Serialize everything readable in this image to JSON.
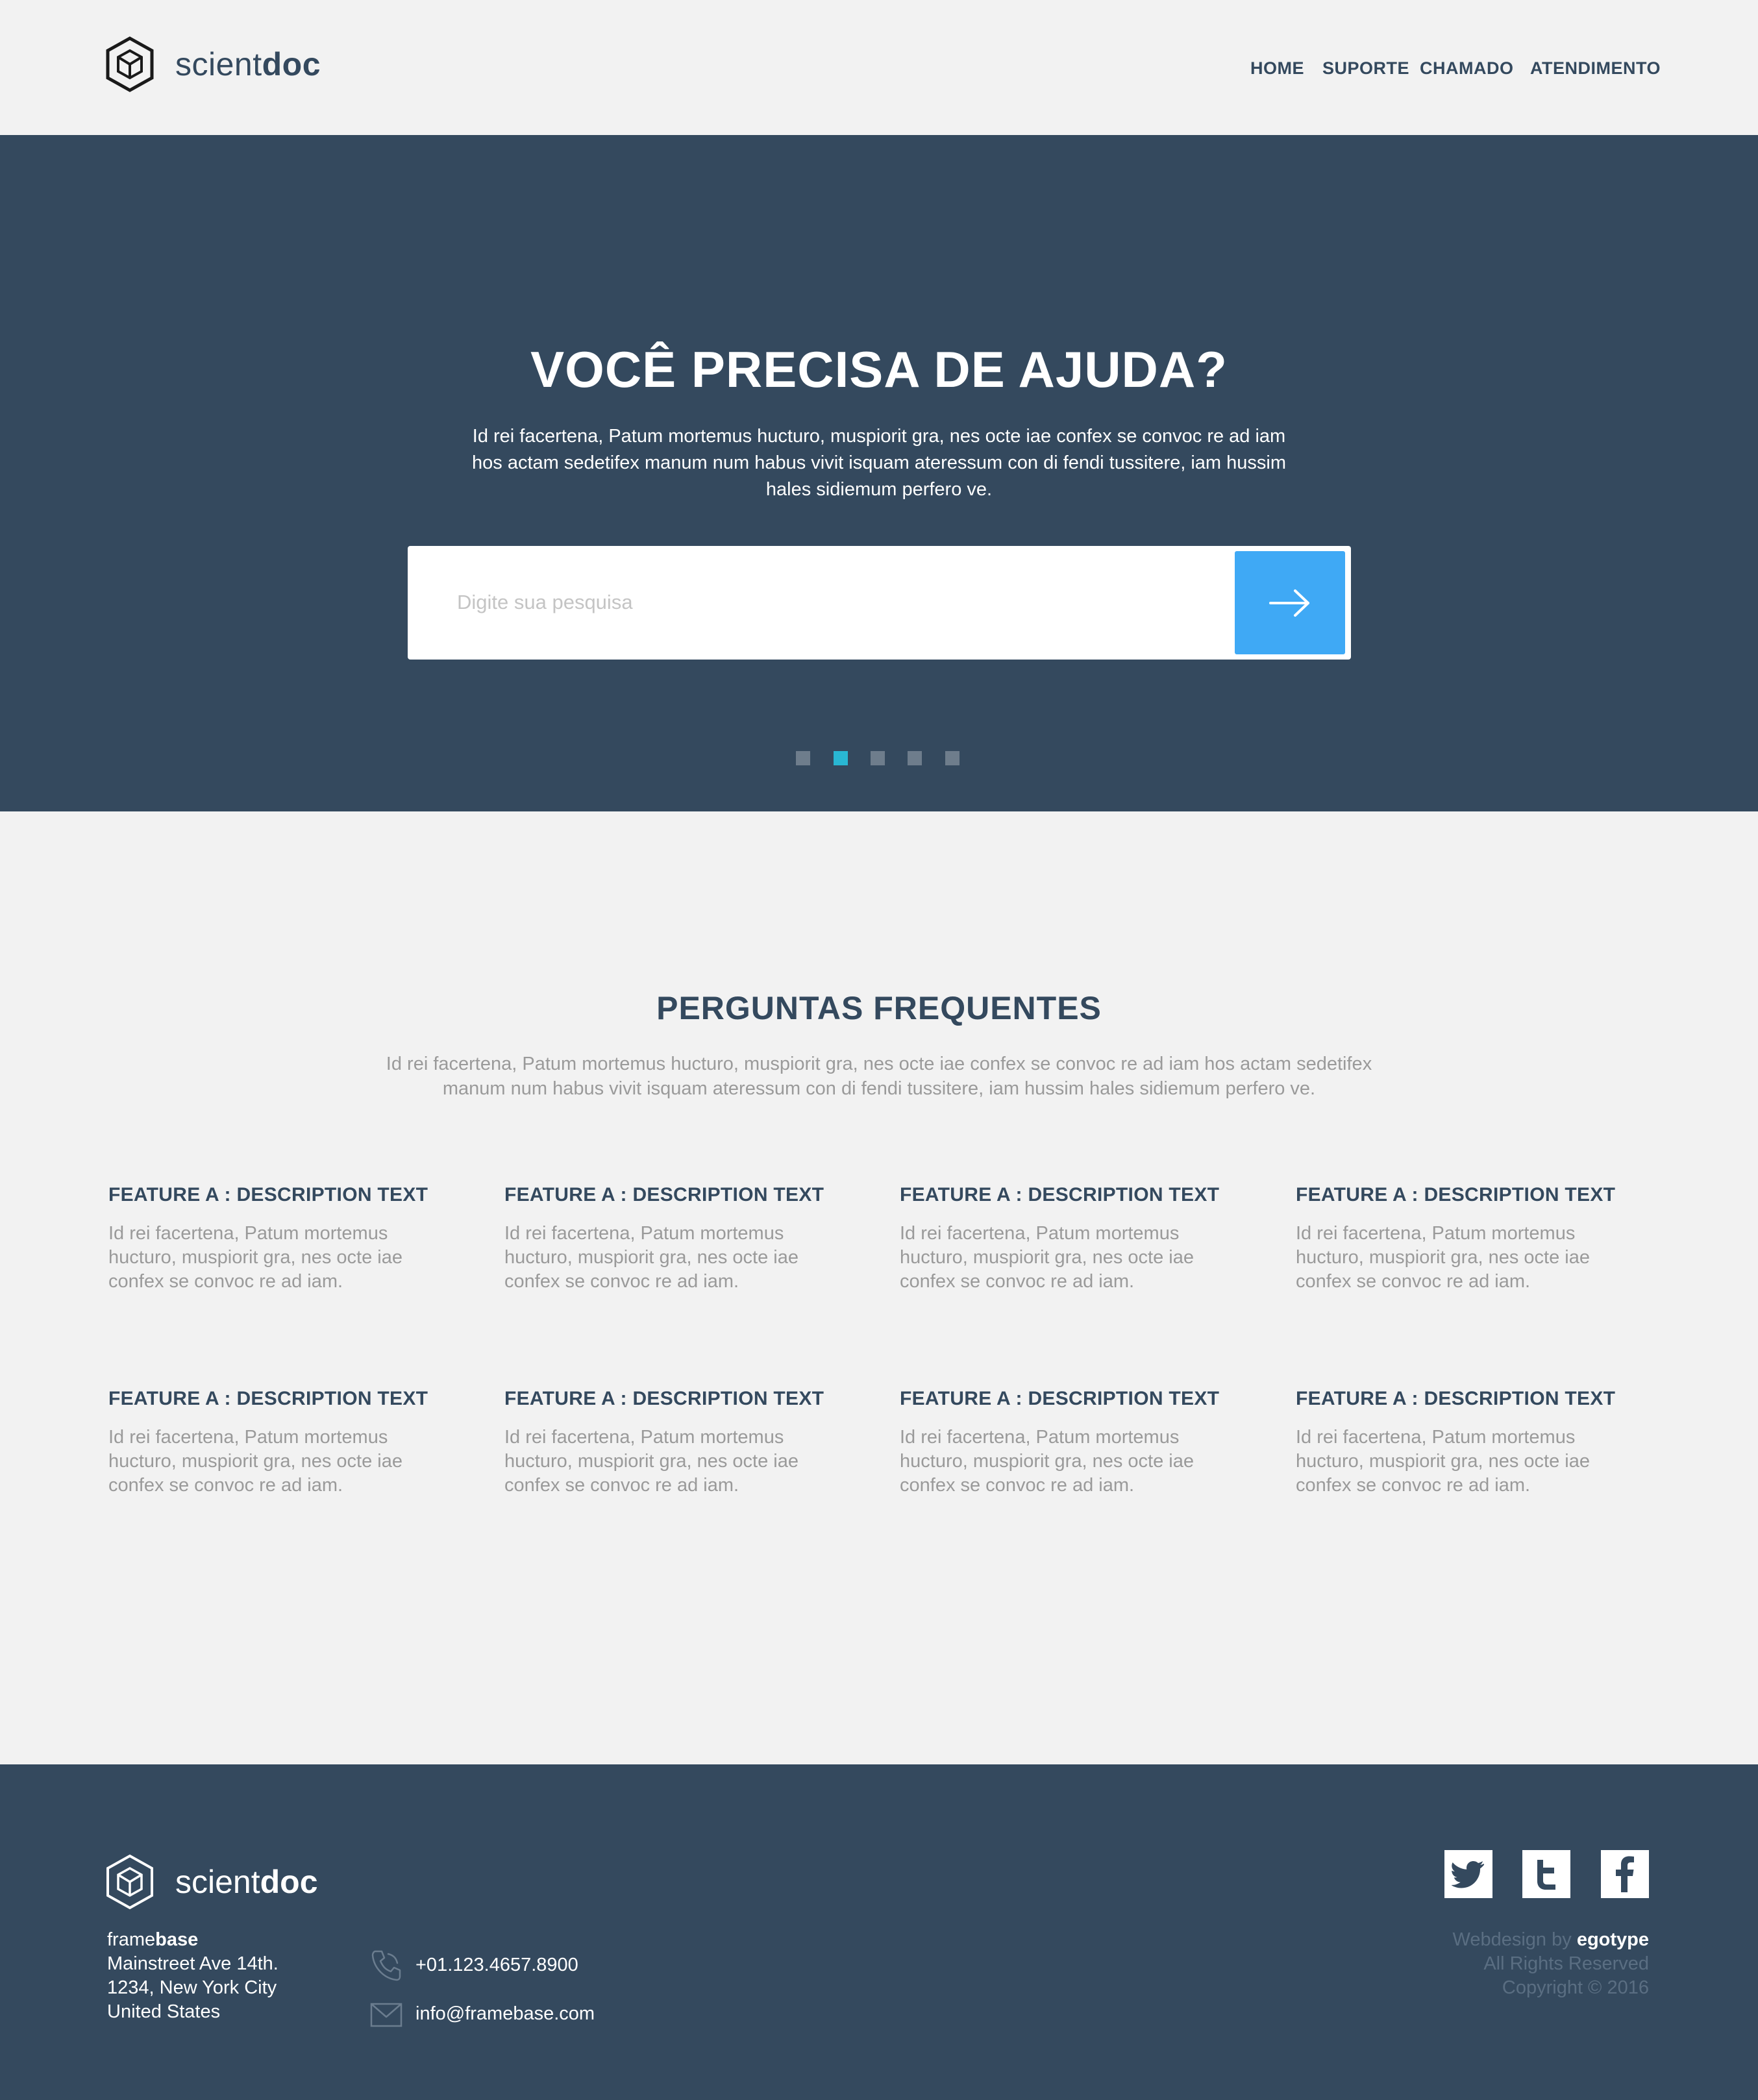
{
  "header": {
    "logo": {
      "word_light": "scient",
      "word_bold": "doc"
    },
    "nav": [
      "HOME",
      "SUPORTE",
      "CHAMADO",
      "ATENDIMENTO"
    ]
  },
  "hero": {
    "title": "VOCÊ PRECISA DE AJUDA?",
    "text_lines": [
      "Id rei facertena, Patum mortemus hucturo, muspiorit gra, nes octe iae confex se convoc re ad iam",
      "hos actam sedetifex manum num habus vivit isquam ateressum con di fendi tussitere, iam hussim",
      "hales sidiemum perfero ve."
    ],
    "search_placeholder": "Digite sua pesquisa",
    "search_button_icon": "arrow-right-icon",
    "slider": {
      "count": 5,
      "active_index": 1
    }
  },
  "faq": {
    "title": "PERGUNTAS FREQUENTES",
    "text_lines": [
      "Id rei facertena, Patum mortemus hucturo, muspiorit gra, nes octe iae confex se convoc re ad iam hos actam sedetifex",
      "manum num habus vivit isquam ateressum con di fendi tussitere, iam hussim hales sidiemum perfero ve."
    ],
    "features": [
      {
        "title": "FEATURE A : DESCRIPTION TEXT",
        "text": "Id rei facertena, Patum mortemus hucturo, muspiorit gra, nes octe iae confex se convoc re ad iam."
      },
      {
        "title": "FEATURE A : DESCRIPTION TEXT",
        "text": "Id rei facertena, Patum mortemus hucturo, muspiorit gra, nes octe iae confex se convoc re ad iam."
      },
      {
        "title": "FEATURE A : DESCRIPTION TEXT",
        "text": "Id rei facertena, Patum mortemus hucturo, muspiorit gra, nes octe iae confex se convoc re ad iam."
      },
      {
        "title": "FEATURE A : DESCRIPTION TEXT",
        "text": "Id rei facertena, Patum mortemus hucturo, muspiorit gra, nes octe iae confex se convoc re ad iam."
      },
      {
        "title": "FEATURE A : DESCRIPTION TEXT",
        "text": "Id rei facertena, Patum mortemus hucturo, muspiorit gra, nes octe iae confex se convoc re ad iam."
      },
      {
        "title": "FEATURE A : DESCRIPTION TEXT",
        "text": "Id rei facertena, Patum mortemus hucturo, muspiorit gra, nes octe iae confex se convoc re ad iam."
      },
      {
        "title": "FEATURE A : DESCRIPTION TEXT",
        "text": "Id rei facertena, Patum mortemus hucturo, muspiorit gra, nes octe iae confex se convoc re ad iam."
      },
      {
        "title": "FEATURE A : DESCRIPTION TEXT",
        "text": "Id rei facertena, Patum mortemus hucturo, muspiorit gra, nes octe iae confex se convoc re ad iam."
      }
    ]
  },
  "footer": {
    "logo": {
      "word_light": "scient",
      "word_bold": "doc"
    },
    "address": {
      "company_light": "frame",
      "company_bold": "base",
      "line1": "Mainstreet Ave 14th.",
      "line2": "1234, New York City",
      "line3": "United States"
    },
    "phone": "+01.123.4657.8900",
    "email": "info@framebase.com",
    "social_icons": [
      "twitter-bird-icon",
      "tumblr-icon",
      "facebook-icon"
    ],
    "credits": {
      "webdesign_prefix": "Webdesign by ",
      "webdesign_brand": "egotype",
      "rights": "All Rights Reserved",
      "copyright": "Copyright © 2016"
    }
  },
  "colors": {
    "navy": "#34495e",
    "page_bg": "#f2f2f2",
    "accent_blue": "#3fa9f5",
    "dot_active": "#29b7d3",
    "muted_text": "#9a9a9a"
  }
}
